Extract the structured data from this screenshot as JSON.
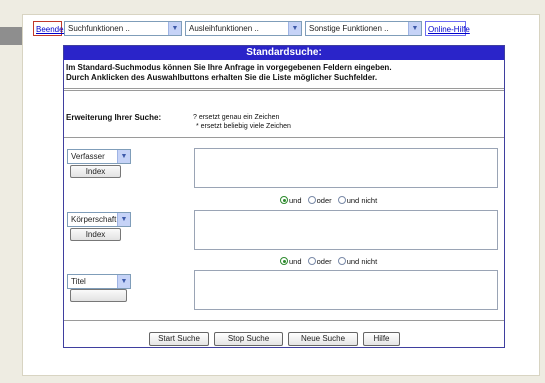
{
  "toolbar": {
    "beenden": "Beenden",
    "suchfunktionen": "Suchfunktionen ..",
    "ausleihfunktionen": "Ausleihfunktionen ..",
    "sonstige": "Sonstige Funktionen ..",
    "online_hilfe": "Online-Hilfe"
  },
  "panel": {
    "title": "Standardsuche:",
    "intro_line1": "Im Standard-Suchmodus können Sie Ihre Anfrage in vorgegebenen Feldern eingeben.",
    "intro_line2": "Durch Anklicken des Auswahlbuttons erhalten Sie die Liste möglicher Suchfelder.",
    "extension_label": "Erweiterung Ihrer Suche:",
    "extension_line1": "? ersetzt genau ein Zeichen",
    "extension_line2": "* ersetzt beliebig viele Zeichen"
  },
  "fields": [
    {
      "select": "Verfasser",
      "index_label": "Index"
    },
    {
      "select": "Körperschaft",
      "index_label": "Index"
    },
    {
      "select": "Titel",
      "index_label": ""
    }
  ],
  "operators": {
    "und": "und",
    "oder": "oder",
    "und_nicht": "und nicht"
  },
  "actions": {
    "start": "Start Suche",
    "stop": "Stop Suche",
    "neue": "Neue Suche",
    "hilfe": "Hilfe"
  }
}
